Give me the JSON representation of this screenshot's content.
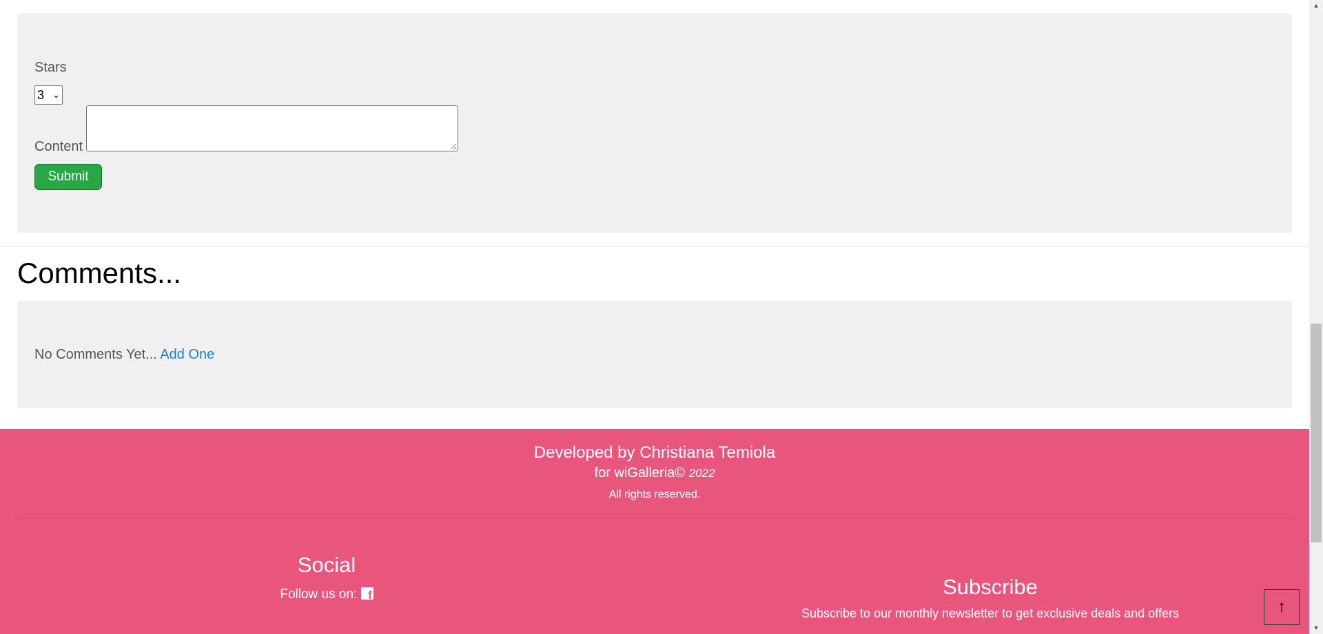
{
  "review_form": {
    "stars_label": "Stars",
    "stars_value": "3",
    "stars_chevron": "⌄",
    "content_label": "Content",
    "content_value": "",
    "submit_label": "Submit"
  },
  "comments": {
    "heading": "Comments...",
    "empty_text": "No Comments Yet...",
    "add_link": "Add One"
  },
  "footer": {
    "developed_by": "Developed by Christiana Temiola",
    "for_text": "for wiGalleria©",
    "year": "2022",
    "rights": "All rights reserved.",
    "social_title": "Social",
    "follow_text": "Follow us on:",
    "facebook_icon": "facebook-icon",
    "subscribe_title": "Subscribe",
    "subscribe_text": "Subscribe to our monthly newsletter to get exclusive deals and offers",
    "accent_color": "#e8567e"
  },
  "back_to_top": {
    "icon": "arrow-up-icon",
    "glyph": "↑"
  },
  "scrollbar": {
    "up_glyph": "▲",
    "down_glyph": "▼"
  }
}
